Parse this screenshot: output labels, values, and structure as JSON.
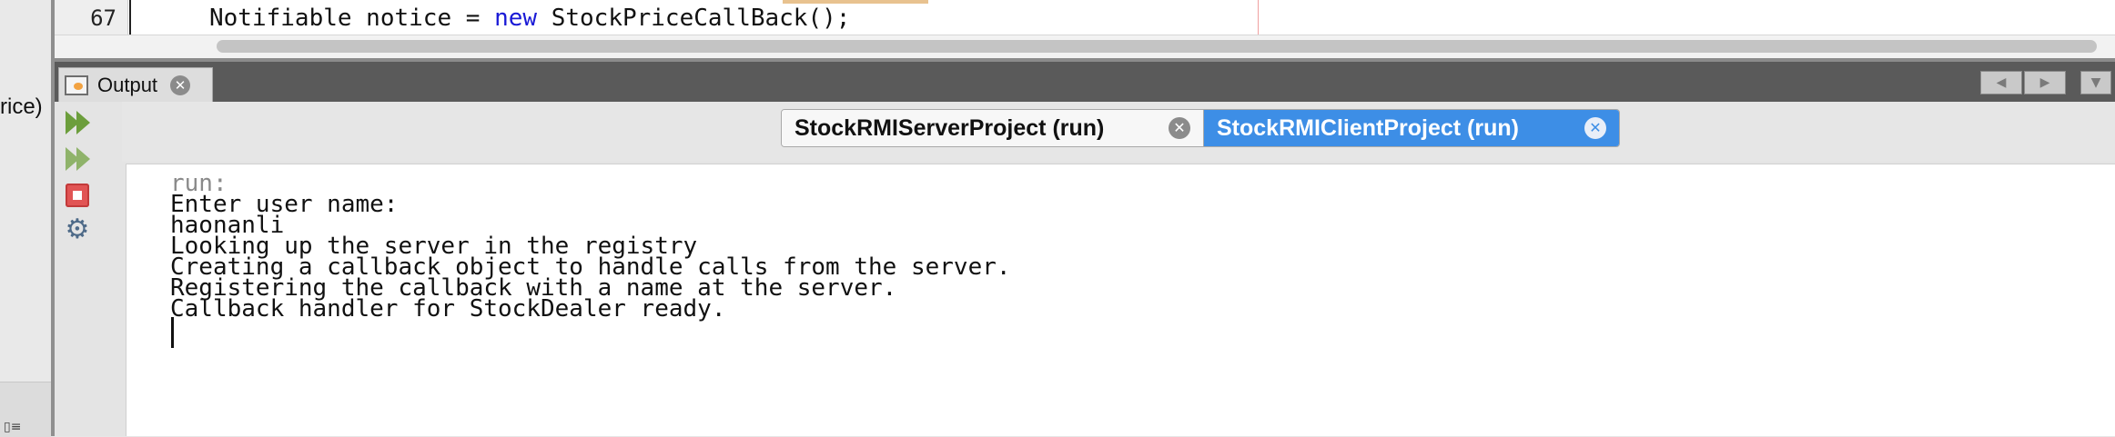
{
  "left_panel": {
    "clipped_text": "rice)"
  },
  "editor": {
    "line_number": "67",
    "code": {
      "part1": "Notifiable notice = ",
      "keyword": "new",
      "part2": " StockPriceCallBack();"
    }
  },
  "output_window": {
    "tab_label": "Output",
    "header_buttons": {
      "scroll_left": "◀",
      "scroll_right": "▶",
      "menu": "▼"
    }
  },
  "toolbar": {
    "rerun": "Re-run",
    "rerun_different": "Re-run with different parameters",
    "stop": "Stop",
    "settings": "Settings"
  },
  "run_tabs": [
    {
      "label": "StockRMIServerProject (run)",
      "active": false,
      "close": "✕"
    },
    {
      "label": "StockRMIClientProject (run)",
      "active": true,
      "close": "✕"
    }
  ],
  "console": {
    "lines": [
      "run:",
      "Enter user name:",
      "haonanli",
      "Looking up the server in the registry",
      "Creating a callback object to handle calls from the server.",
      "Registering the callback with a name at the server.",
      "Callback handler for StockDealer ready."
    ]
  },
  "colors": {
    "active_tab": "#3d8ee6",
    "keyword": "#1a1ad6",
    "run_green": "#6c9e3c",
    "stop_red": "#e15454"
  }
}
